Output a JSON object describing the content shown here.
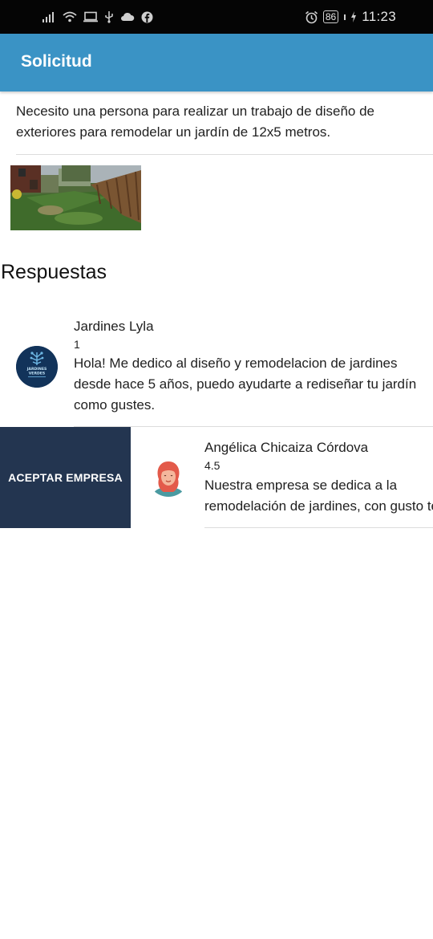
{
  "status_bar": {
    "battery": "86",
    "time": "11:23",
    "icons": [
      "signal-icon",
      "wifi-icon",
      "screen-icon",
      "usb-icon",
      "cloud-icon",
      "facebook-icon",
      "alarm-icon",
      "battery-icon",
      "charging-icon"
    ]
  },
  "app_bar": {
    "title": "Solicitud"
  },
  "request": {
    "description": "Necesito una persona para realizar un trabajo de diseño de exteriores para remodelar un jardín de 12x5 metros."
  },
  "responses_section": {
    "title": "Respuestas"
  },
  "responses": [
    {
      "name": "Jardines Lyla",
      "rating": "1",
      "message": "Hola! Me dedico al diseño y remodelacion de jardines desde hace 5 años, puedo ayudarte a rediseñar tu jardín como gustes.",
      "avatar": "company-logo",
      "avatar_label": "JARDINES VERDES"
    },
    {
      "name": "Angélica Chicaiza Córdova",
      "rating": "4.5",
      "message": "Nuestra empresa se dedica a la remodelación de jardines, con gusto te ayudaremos en",
      "avatar": "person-avatar",
      "action_label": "ACEPTAR EMPRESA"
    }
  ],
  "colors": {
    "app_bar": "#3a93c5",
    "accept_button": "#233550",
    "status_bar": "#050505"
  }
}
